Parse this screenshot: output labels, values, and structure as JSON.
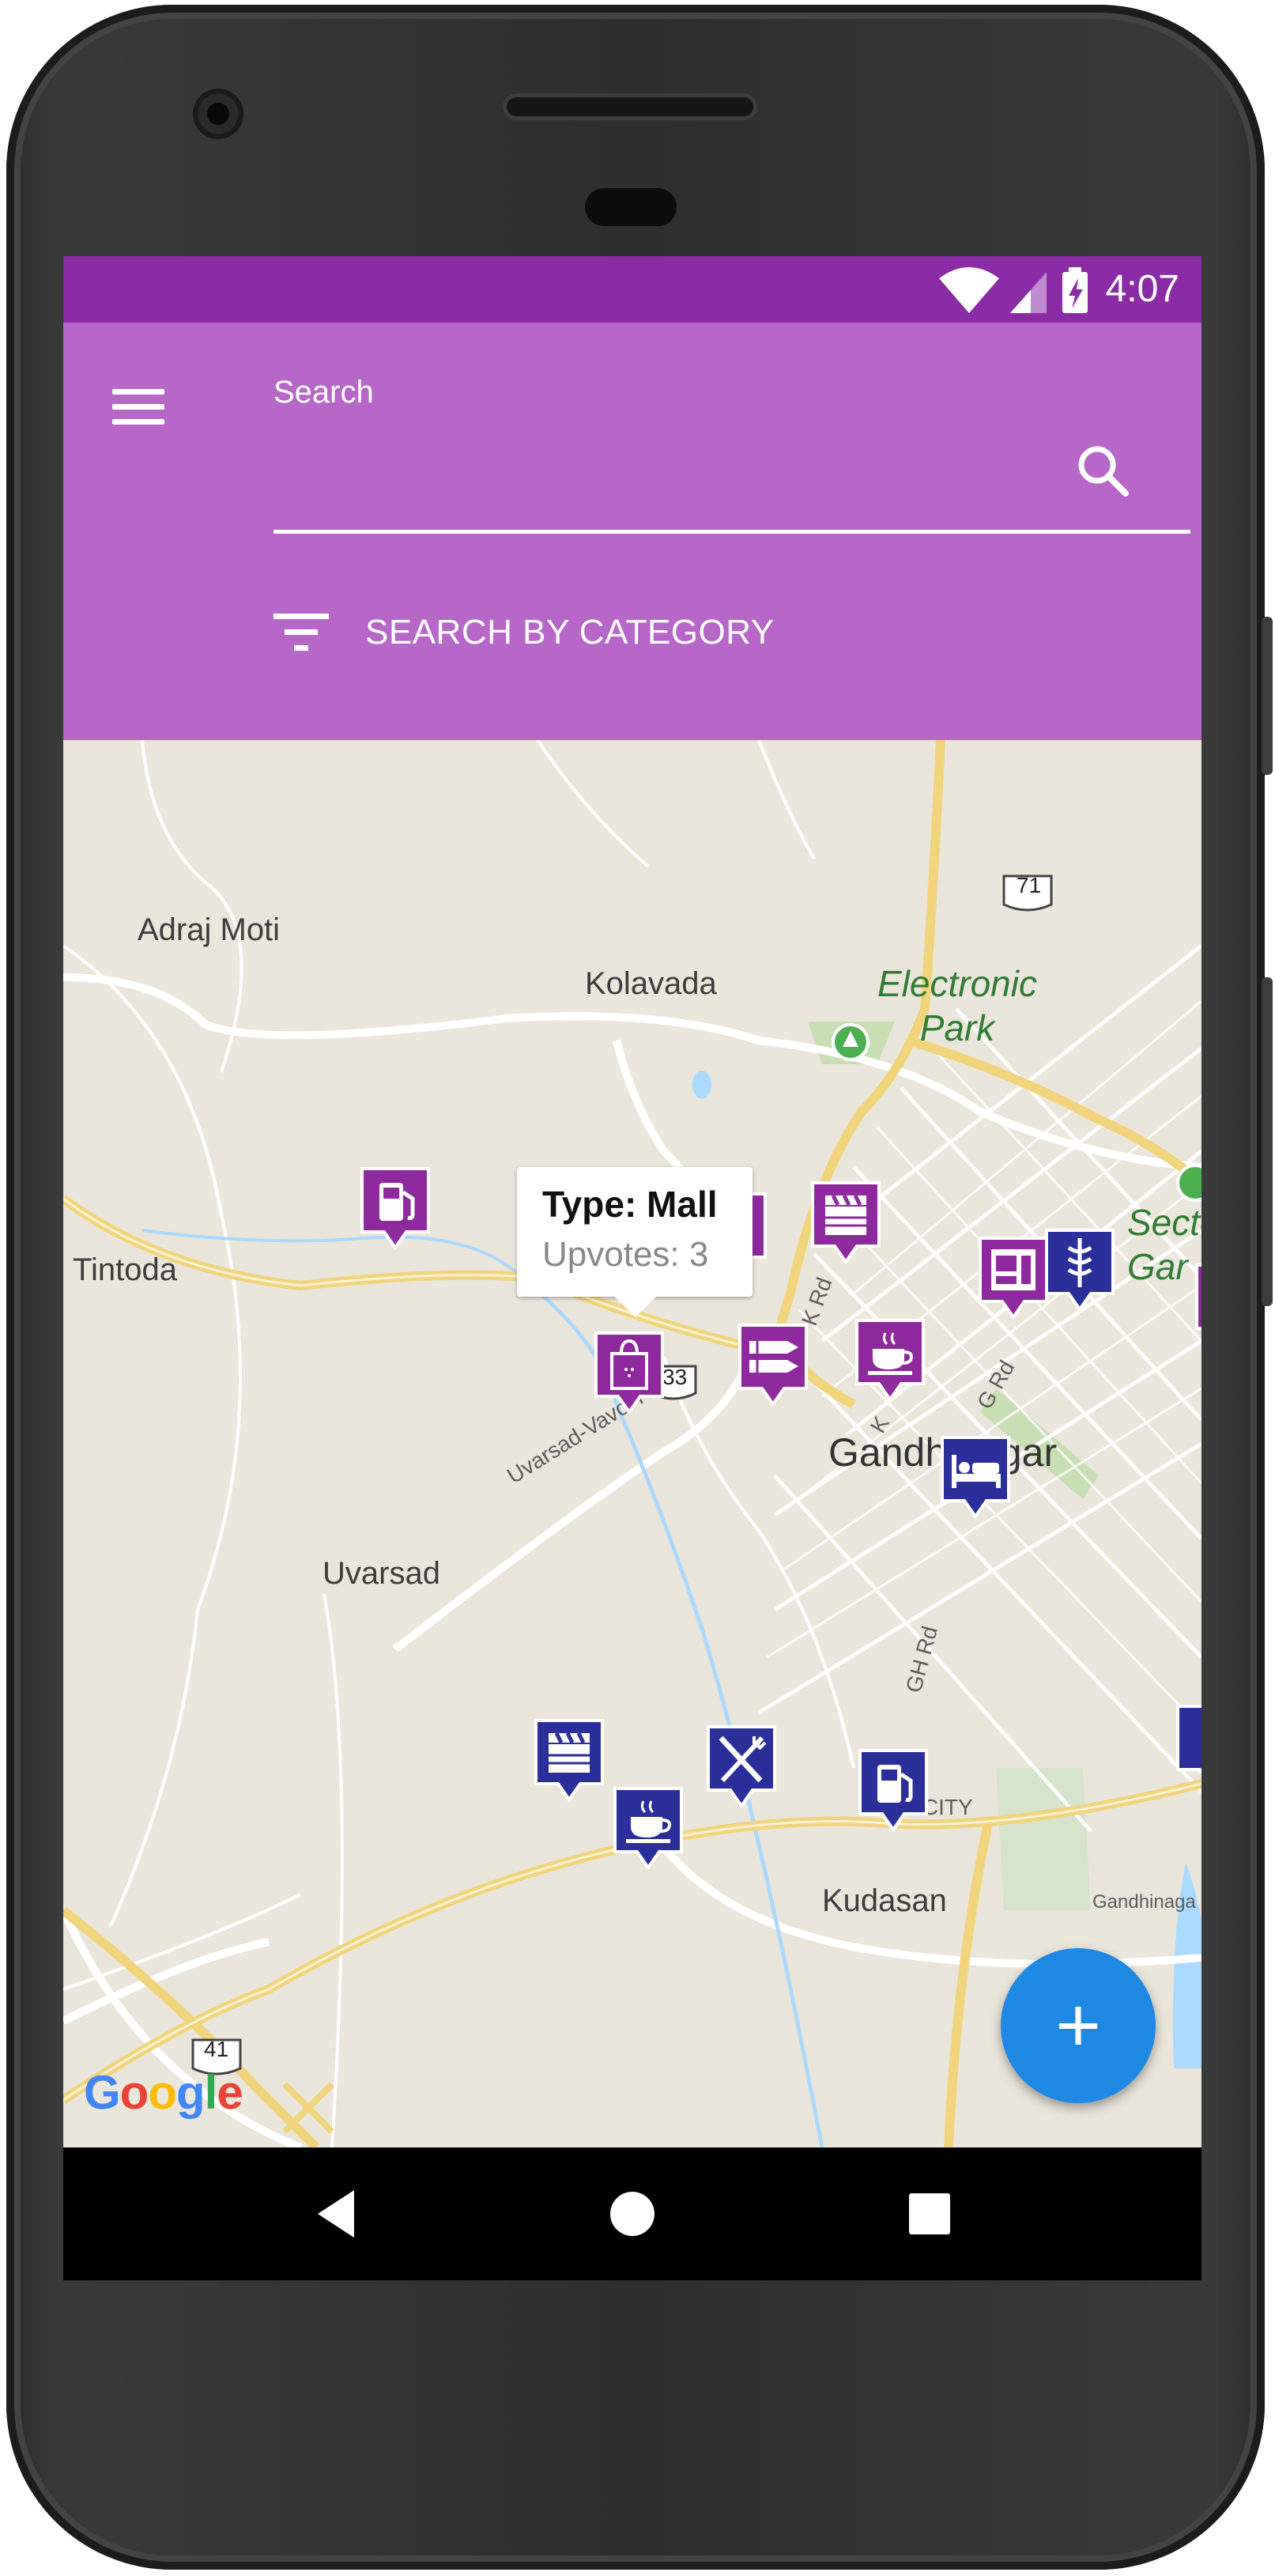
{
  "status_bar": {
    "time": "4:07",
    "icons": [
      "wifi-icon",
      "signal-icon",
      "battery-charging-icon"
    ],
    "color": "#8a2ca6"
  },
  "app_bar": {
    "color": "#b667c8",
    "menu_icon": "hamburger-menu-icon",
    "search_label": "Search",
    "search_value": "",
    "search_icon": "search-icon",
    "category_button_label": "SEARCH BY CATEGORY",
    "category_icon": "filter-list-icon"
  },
  "map": {
    "labels": {
      "adraj_moti": "Adraj Moti",
      "kolavada": "Kolavada",
      "electronic_park": "Electronic\nPark",
      "tintoda": "Tintoda",
      "sector_garden": "Secto\nGar",
      "gandhinagar": "Gandhinagar",
      "uvarsad": "Uvarsad",
      "uvarsad_vavol_rd": "Uvarsad-Vavol Rd",
      "k_rd": "K Rd",
      "k_rd_2": "K",
      "g_rd": "G Rd",
      "gh_rd": "GH Rd",
      "infocity": "INFOCITY",
      "kudasan": "Kudasan",
      "gandhinagar_road": "Gandhinaga",
      "highway_71": "71",
      "highway_41": "41",
      "highway_33": "33"
    },
    "info_window": {
      "type_text": "Type: Mall",
      "upvotes_text": "Upvotes: 3"
    },
    "markers": [
      {
        "name": "fuel-marker-1",
        "icon": "fuel-icon",
        "color": "#8e2a9e"
      },
      {
        "name": "cinema-marker-1",
        "icon": "clapperboard-icon",
        "color": "#8e2a9e"
      },
      {
        "name": "partial-marker",
        "icon": "wrench-icon",
        "color": "#8e2a9e"
      },
      {
        "name": "atm-marker",
        "icon": "atm-icon",
        "color": "#8e2a9e"
      },
      {
        "name": "hospital-marker",
        "icon": "caduceus-icon",
        "color": "#2b2f9a"
      },
      {
        "name": "mall-marker",
        "icon": "shopping-bag-icon",
        "color": "#8e2a9e"
      },
      {
        "name": "stationery-marker",
        "icon": "pencils-icon",
        "color": "#8e2a9e"
      },
      {
        "name": "cafe-marker-1",
        "icon": "coffee-cup-icon",
        "color": "#8e2a9e"
      },
      {
        "name": "hotel-marker",
        "icon": "bed-icon",
        "color": "#2b2f9a"
      },
      {
        "name": "cinema-marker-2",
        "icon": "clapperboard-icon",
        "color": "#2b2f9a"
      },
      {
        "name": "restaurant-marker",
        "icon": "fork-knife-icon",
        "color": "#2b2f9a"
      },
      {
        "name": "fuel-marker-2",
        "icon": "fuel-icon",
        "color": "#2b2f9a"
      },
      {
        "name": "cafe-marker-2",
        "icon": "coffee-cup-icon",
        "color": "#2b2f9a"
      }
    ],
    "google_logo_text": [
      "G",
      "o",
      "o",
      "g",
      "l",
      "e"
    ],
    "google_logo_colors": [
      "#4285f4",
      "#ea4335",
      "#fbbc05",
      "#4285f4",
      "#34a853",
      "#ea4335"
    ]
  },
  "fab": {
    "icon": "plus-icon",
    "color": "#1e88e5"
  },
  "nav_bar": {
    "icons": [
      "back-icon",
      "home-icon",
      "recents-icon"
    ]
  }
}
